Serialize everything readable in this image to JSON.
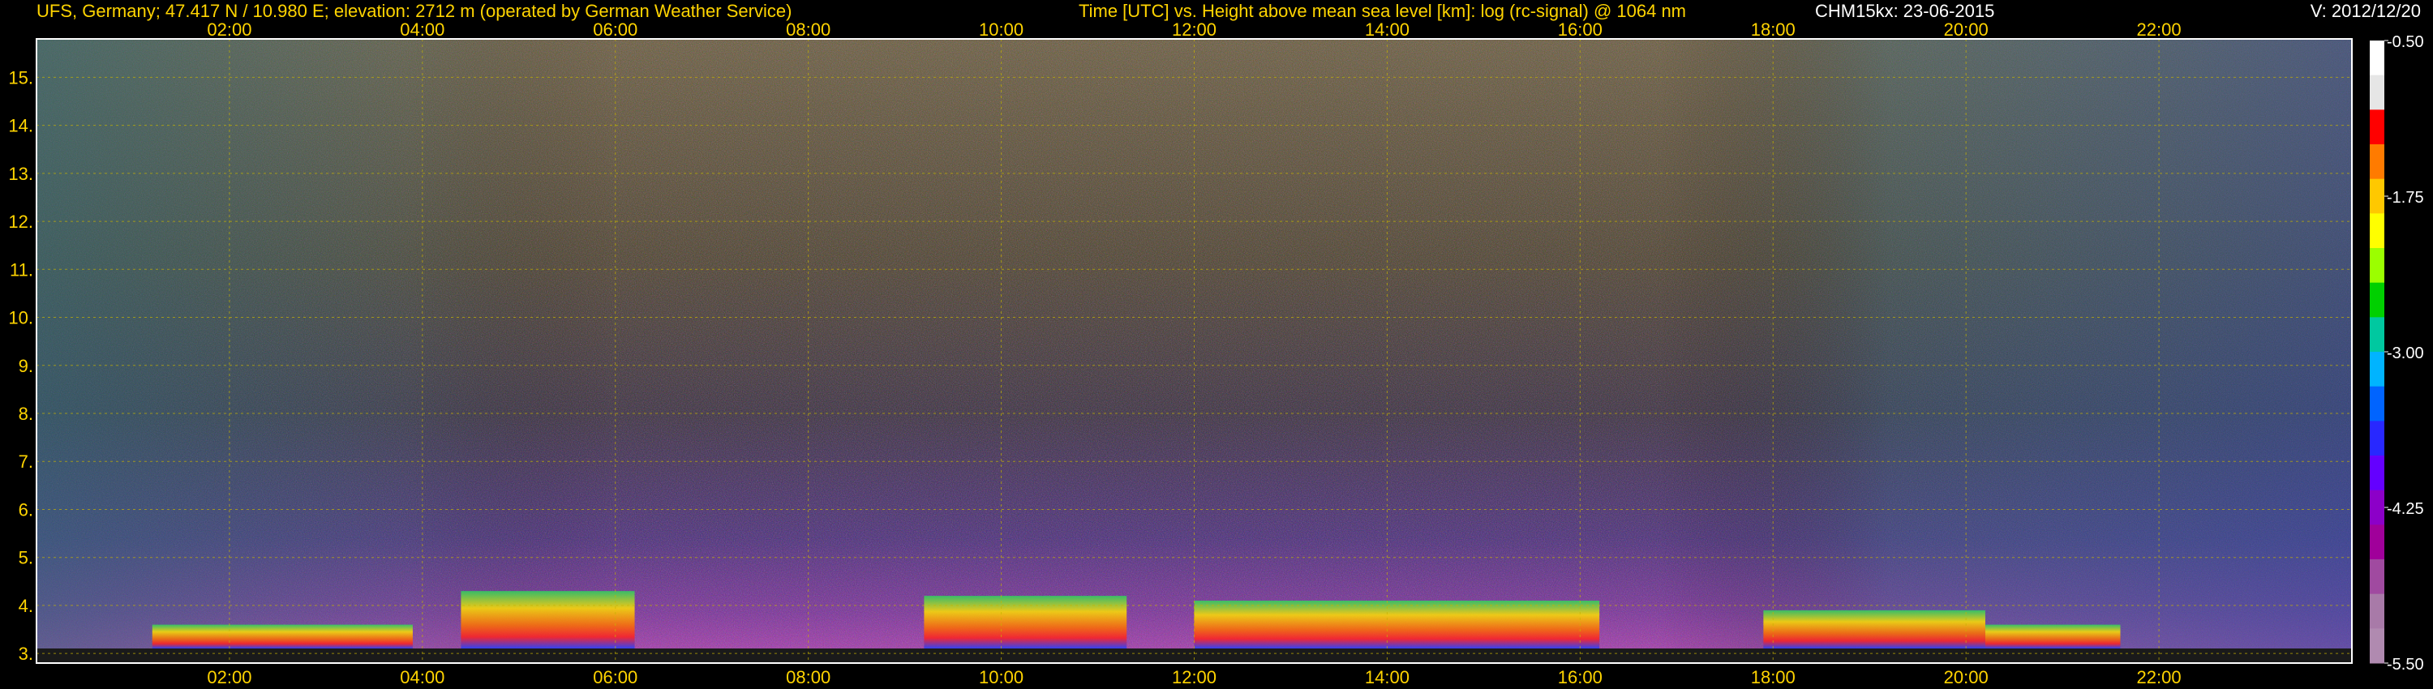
{
  "header": {
    "station": "UFS, Germany; 47.417 N / 10.980 E; elevation: 2712 m  (operated by German Weather Service)",
    "plot_description": "Time [UTC] vs. Height above mean sea level [km]: log (rc-signal) @ 1064 nm",
    "instrument_date": "CHM15kx: 23-06-2015",
    "version": "V: 2012/12/20"
  },
  "colors": {
    "header_text": "#ffd400",
    "axis_text": "#ffd400",
    "grid": "#c8b400",
    "frame": "#ffffff",
    "colorbar_text": "#ffffff",
    "background": "#000000"
  },
  "chart_data": {
    "type": "heatmap",
    "title": "Time [UTC] vs. Height above mean sea level [km]: log (rc-signal) @ 1064 nm",
    "xlabel": "Time [UTC]",
    "ylabel": "Height above mean sea level [km]",
    "x_ticks": [
      "02:00",
      "04:00",
      "06:00",
      "08:00",
      "10:00",
      "12:00",
      "14:00",
      "16:00",
      "18:00",
      "20:00",
      "22:00"
    ],
    "x_tick_hours": [
      2,
      4,
      6,
      8,
      10,
      12,
      14,
      16,
      18,
      20,
      22
    ],
    "xlim_hours": [
      0,
      24
    ],
    "y_ticks": [
      "3.",
      "4.",
      "5.",
      "6.",
      "7.",
      "8.",
      "9.",
      "10.",
      "11.",
      "12.",
      "13.",
      "14.",
      "15."
    ],
    "y_tick_values": [
      3,
      4,
      5,
      6,
      7,
      8,
      9,
      10,
      11,
      12,
      13,
      14,
      15
    ],
    "ylim_km": [
      2.8,
      15.8
    ],
    "grid": true,
    "colorbar": {
      "labels": [
        "-0.50",
        "-1.75",
        "-3.00",
        "-4.25",
        "-5.50"
      ],
      "values": [
        -0.5,
        -1.75,
        -3.0,
        -4.25,
        -5.5
      ],
      "range": [
        -5.5,
        -0.5
      ],
      "colors_top_to_bottom": [
        "#ffffff",
        "#e6e6e6",
        "#ff0000",
        "#ff7b00",
        "#ffc800",
        "#ffff00",
        "#9bff00",
        "#00d000",
        "#00c8a0",
        "#00b4ff",
        "#0064ff",
        "#2828ff",
        "#6400ff",
        "#8c00c8",
        "#a0009a",
        "#a04aa0",
        "#a87aa8",
        "#b08ab0"
      ]
    },
    "aerosol_layer_segments_hours": [
      {
        "start": 1.2,
        "end": 3.9,
        "top_km": 3.6
      },
      {
        "start": 4.4,
        "end": 6.2,
        "top_km": 4.3
      },
      {
        "start": 9.2,
        "end": 11.3,
        "top_km": 4.2
      },
      {
        "start": 12.0,
        "end": 16.2,
        "top_km": 4.1
      },
      {
        "start": 17.9,
        "end": 20.2,
        "top_km": 3.9
      },
      {
        "start": 20.2,
        "end": 21.6,
        "top_km": 3.6
      }
    ]
  }
}
